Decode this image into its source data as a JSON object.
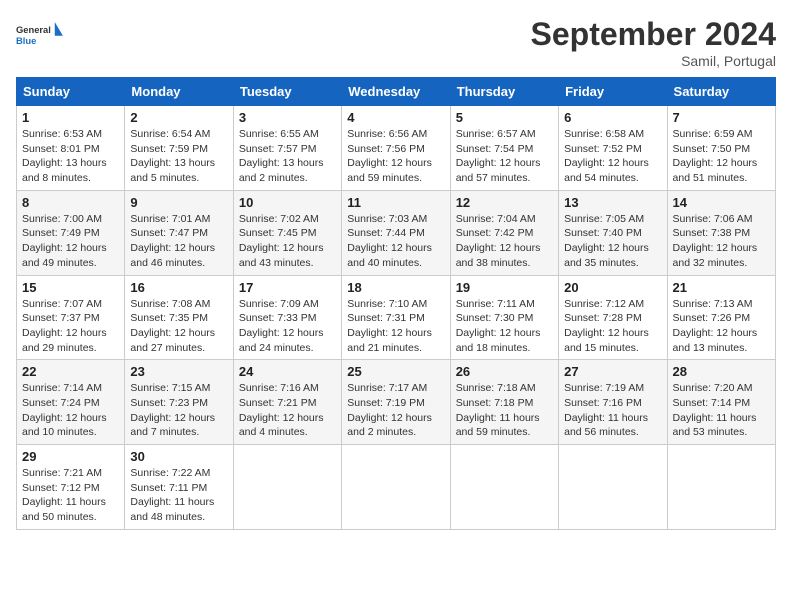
{
  "header": {
    "logo_general": "General",
    "logo_blue": "Blue",
    "month_title": "September 2024",
    "subtitle": "Samil, Portugal"
  },
  "weekdays": [
    "Sunday",
    "Monday",
    "Tuesday",
    "Wednesday",
    "Thursday",
    "Friday",
    "Saturday"
  ],
  "weeks": [
    [
      {
        "day": "1",
        "sunrise": "6:53 AM",
        "sunset": "8:01 PM",
        "daylight": "13 hours and 8 minutes."
      },
      {
        "day": "2",
        "sunrise": "6:54 AM",
        "sunset": "7:59 PM",
        "daylight": "13 hours and 5 minutes."
      },
      {
        "day": "3",
        "sunrise": "6:55 AM",
        "sunset": "7:57 PM",
        "daylight": "13 hours and 2 minutes."
      },
      {
        "day": "4",
        "sunrise": "6:56 AM",
        "sunset": "7:56 PM",
        "daylight": "12 hours and 59 minutes."
      },
      {
        "day": "5",
        "sunrise": "6:57 AM",
        "sunset": "7:54 PM",
        "daylight": "12 hours and 57 minutes."
      },
      {
        "day": "6",
        "sunrise": "6:58 AM",
        "sunset": "7:52 PM",
        "daylight": "12 hours and 54 minutes."
      },
      {
        "day": "7",
        "sunrise": "6:59 AM",
        "sunset": "7:50 PM",
        "daylight": "12 hours and 51 minutes."
      }
    ],
    [
      {
        "day": "8",
        "sunrise": "7:00 AM",
        "sunset": "7:49 PM",
        "daylight": "12 hours and 49 minutes."
      },
      {
        "day": "9",
        "sunrise": "7:01 AM",
        "sunset": "7:47 PM",
        "daylight": "12 hours and 46 minutes."
      },
      {
        "day": "10",
        "sunrise": "7:02 AM",
        "sunset": "7:45 PM",
        "daylight": "12 hours and 43 minutes."
      },
      {
        "day": "11",
        "sunrise": "7:03 AM",
        "sunset": "7:44 PM",
        "daylight": "12 hours and 40 minutes."
      },
      {
        "day": "12",
        "sunrise": "7:04 AM",
        "sunset": "7:42 PM",
        "daylight": "12 hours and 38 minutes."
      },
      {
        "day": "13",
        "sunrise": "7:05 AM",
        "sunset": "7:40 PM",
        "daylight": "12 hours and 35 minutes."
      },
      {
        "day": "14",
        "sunrise": "7:06 AM",
        "sunset": "7:38 PM",
        "daylight": "12 hours and 32 minutes."
      }
    ],
    [
      {
        "day": "15",
        "sunrise": "7:07 AM",
        "sunset": "7:37 PM",
        "daylight": "12 hours and 29 minutes."
      },
      {
        "day": "16",
        "sunrise": "7:08 AM",
        "sunset": "7:35 PM",
        "daylight": "12 hours and 27 minutes."
      },
      {
        "day": "17",
        "sunrise": "7:09 AM",
        "sunset": "7:33 PM",
        "daylight": "12 hours and 24 minutes."
      },
      {
        "day": "18",
        "sunrise": "7:10 AM",
        "sunset": "7:31 PM",
        "daylight": "12 hours and 21 minutes."
      },
      {
        "day": "19",
        "sunrise": "7:11 AM",
        "sunset": "7:30 PM",
        "daylight": "12 hours and 18 minutes."
      },
      {
        "day": "20",
        "sunrise": "7:12 AM",
        "sunset": "7:28 PM",
        "daylight": "12 hours and 15 minutes."
      },
      {
        "day": "21",
        "sunrise": "7:13 AM",
        "sunset": "7:26 PM",
        "daylight": "12 hours and 13 minutes."
      }
    ],
    [
      {
        "day": "22",
        "sunrise": "7:14 AM",
        "sunset": "7:24 PM",
        "daylight": "12 hours and 10 minutes."
      },
      {
        "day": "23",
        "sunrise": "7:15 AM",
        "sunset": "7:23 PM",
        "daylight": "12 hours and 7 minutes."
      },
      {
        "day": "24",
        "sunrise": "7:16 AM",
        "sunset": "7:21 PM",
        "daylight": "12 hours and 4 minutes."
      },
      {
        "day": "25",
        "sunrise": "7:17 AM",
        "sunset": "7:19 PM",
        "daylight": "12 hours and 2 minutes."
      },
      {
        "day": "26",
        "sunrise": "7:18 AM",
        "sunset": "7:18 PM",
        "daylight": "11 hours and 59 minutes."
      },
      {
        "day": "27",
        "sunrise": "7:19 AM",
        "sunset": "7:16 PM",
        "daylight": "11 hours and 56 minutes."
      },
      {
        "day": "28",
        "sunrise": "7:20 AM",
        "sunset": "7:14 PM",
        "daylight": "11 hours and 53 minutes."
      }
    ],
    [
      {
        "day": "29",
        "sunrise": "7:21 AM",
        "sunset": "7:12 PM",
        "daylight": "11 hours and 50 minutes."
      },
      {
        "day": "30",
        "sunrise": "7:22 AM",
        "sunset": "7:11 PM",
        "daylight": "11 hours and 48 minutes."
      },
      null,
      null,
      null,
      null,
      null
    ]
  ]
}
